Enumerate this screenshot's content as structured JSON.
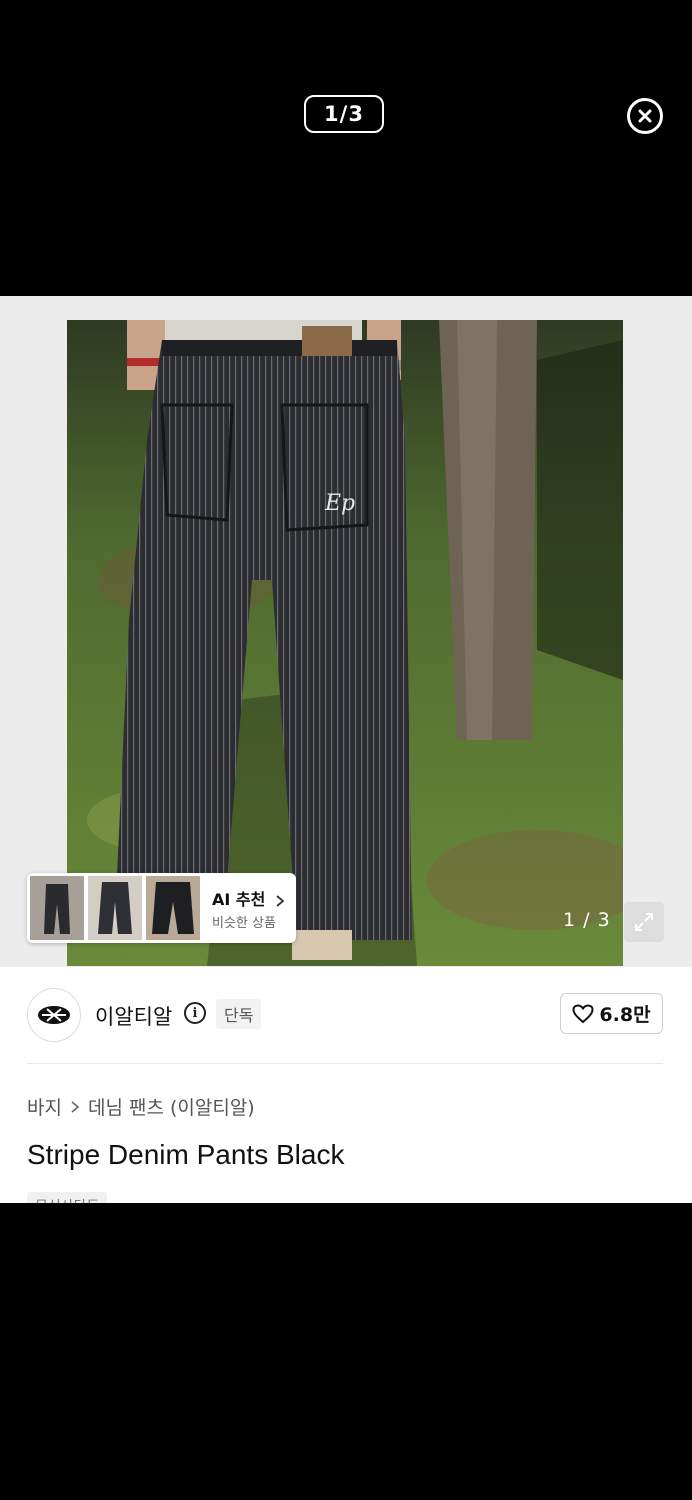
{
  "viewer": {
    "counter": "1/3",
    "close_icon": "close-circle-icon"
  },
  "gallery": {
    "photo_counter": "1 / 3",
    "expand_icon": "expand-arrows-icon",
    "ai_recommend": {
      "title": "AI 추천",
      "subtitle": "비슷한 상품",
      "chevron_icon": "chevron-right-icon"
    }
  },
  "brand": {
    "name": "이알티알",
    "info_icon": "info-circle-icon",
    "badge": "단독"
  },
  "like": {
    "icon": "heart-icon",
    "count": "6.8만"
  },
  "breadcrumb": {
    "category": "바지",
    "separator_icon": "chevron-right-icon",
    "subcategory": "데님 팬츠 (이알티알)"
  },
  "product": {
    "title": "Stripe Denim Pants Black",
    "tag": "무신사단독"
  },
  "colors": {
    "overlay_bg": "#000000",
    "sheet_bg": "#ffffff",
    "gallery_bg": "#ececec"
  }
}
